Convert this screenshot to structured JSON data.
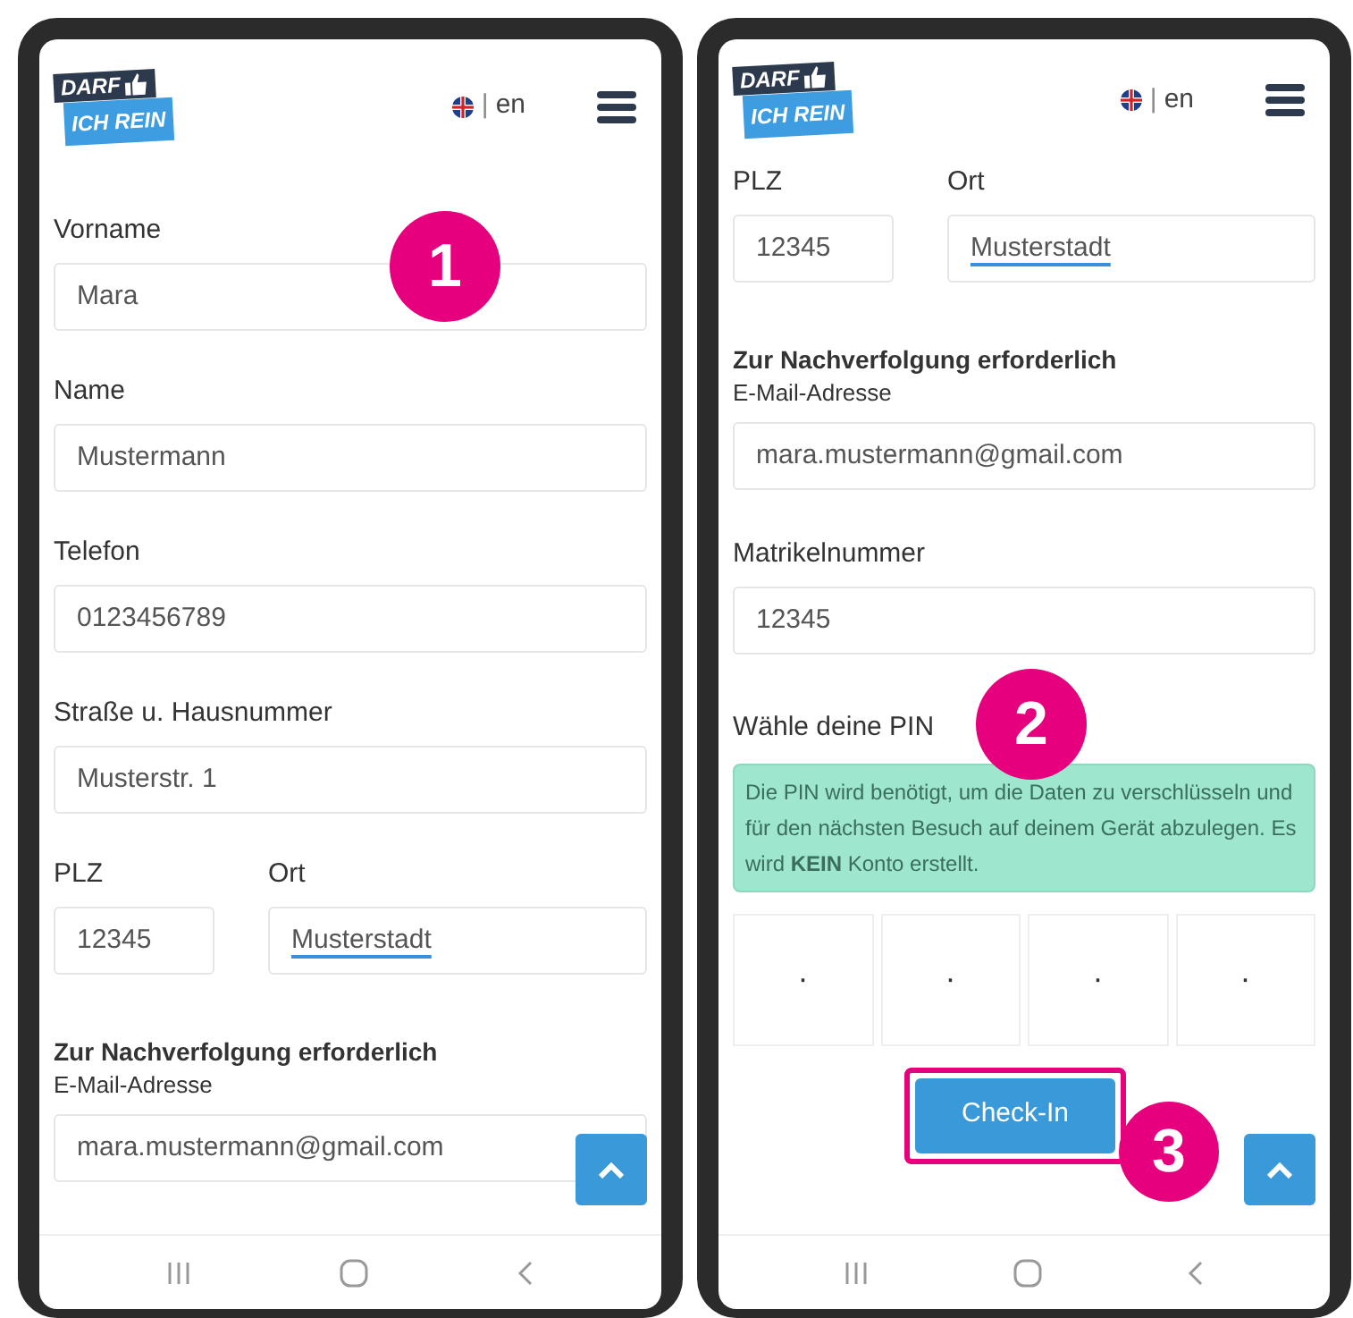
{
  "phones": [
    {
      "header": {
        "logo_top": "DARF",
        "logo_bottom": "ICH REIN",
        "separator": "|",
        "language": "en"
      },
      "callouts": [
        "1"
      ],
      "content": [
        {
          "kind": "field",
          "label": "Vorname",
          "value": "Mara"
        },
        {
          "kind": "field",
          "label": "Name",
          "value": "Mustermann"
        },
        {
          "kind": "field",
          "label": "Telefon",
          "value": "0123456789"
        },
        {
          "kind": "field",
          "label": "Straße u. Hausnummer",
          "value": "Musterstr. 1"
        },
        {
          "kind": "pair",
          "fields": [
            {
              "label": "PLZ",
              "value": "12345",
              "spellcheck": false
            },
            {
              "label": "Ort",
              "value": "Musterstadt",
              "spellcheck": true
            }
          ]
        },
        {
          "kind": "heading",
          "text": "Zur Nachverfolgung erforderlich"
        },
        {
          "kind": "compact_field",
          "label": "E-Mail-Adresse",
          "value": "mara.mustermann@gmail.com"
        }
      ]
    },
    {
      "header": {
        "logo_top": "DARF",
        "logo_bottom": "ICH REIN",
        "separator": "|",
        "language": "en"
      },
      "callouts": [
        "2",
        "3"
      ],
      "content": [
        {
          "kind": "pair",
          "fields": [
            {
              "label": "PLZ",
              "value": "12345",
              "spellcheck": false
            },
            {
              "label": "Ort",
              "value": "Musterstadt",
              "spellcheck": true
            }
          ]
        },
        {
          "kind": "heading",
          "text": "Zur Nachverfolgung erforderlich"
        },
        {
          "kind": "compact_field",
          "label": "E-Mail-Adresse",
          "value": "mara.mustermann@gmail.com"
        },
        {
          "kind": "field",
          "label": "Matrikelnummer",
          "value": "12345"
        },
        {
          "kind": "label",
          "text": "Wähle deine PIN"
        },
        {
          "kind": "info",
          "text": "Die PIN wird benötigt, um die Daten zu verschlüsseln und für den nächsten Besuch auf deinem Gerät abzulegen. Es wird **KEIN** Konto erstellt."
        },
        {
          "kind": "pin",
          "digits": [
            "·",
            "·",
            "·",
            "·"
          ]
        },
        {
          "kind": "button",
          "text": "Check-In",
          "highlighted": true
        }
      ]
    }
  ]
}
